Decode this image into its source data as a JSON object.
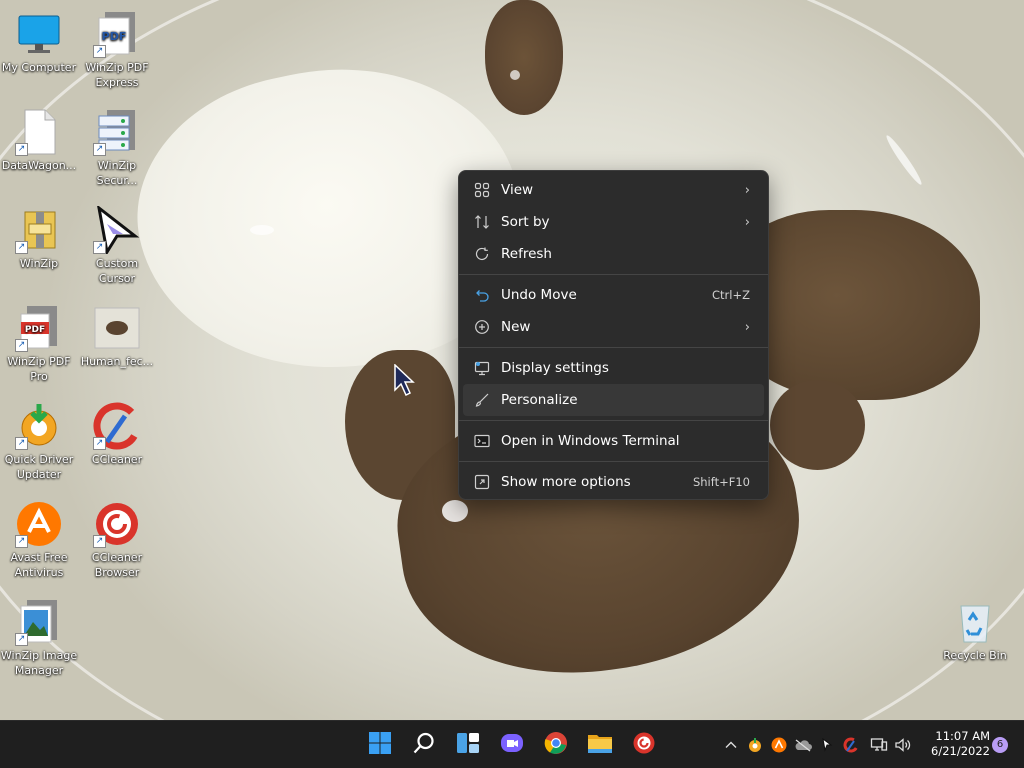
{
  "desktop_icons": [
    {
      "id": "my-computer",
      "label": "My Computer",
      "icon": "monitor-icon"
    },
    {
      "id": "winzip-pdf-express",
      "label": "WinZip PDF Express",
      "icon": "pdf-icon"
    },
    {
      "id": "datawagon",
      "label": "DataWagon...",
      "icon": "file-icon"
    },
    {
      "id": "winzip-secure",
      "label": "WinZip Secur...",
      "icon": "server-icon"
    },
    {
      "id": "winzip",
      "label": "WinZip",
      "icon": "winzip-icon"
    },
    {
      "id": "custom-cursor",
      "label": "Custom Cursor",
      "icon": "cursor-icon"
    },
    {
      "id": "winzip-pdf-pro",
      "label": "WinZip PDF Pro",
      "icon": "pdf-icon"
    },
    {
      "id": "human-fec",
      "label": "Human_fec...",
      "icon": "image-thumbnail-icon"
    },
    {
      "id": "quick-driver-updater",
      "label": "Quick Driver Updater",
      "icon": "driver-updater-icon"
    },
    {
      "id": "ccleaner",
      "label": "CCleaner",
      "icon": "ccleaner-icon"
    },
    {
      "id": "avast-free-antivirus",
      "label": "Avast Free Antivirus",
      "icon": "avast-icon"
    },
    {
      "id": "ccleaner-browser",
      "label": "CCleaner Browser",
      "icon": "ccleaner-browser-icon"
    },
    {
      "id": "winzip-image-manager",
      "label": "WinZip Image Manager",
      "icon": "image-manager-icon"
    },
    {
      "id": "recycle-bin",
      "label": "Recycle Bin",
      "icon": "recycle-bin-icon"
    }
  ],
  "context_menu": {
    "items": [
      {
        "label": "View",
        "icon": "grid-icon",
        "submenu": true
      },
      {
        "label": "Sort by",
        "icon": "sort-icon",
        "submenu": true
      },
      {
        "label": "Refresh",
        "icon": "refresh-icon"
      },
      {
        "label": "Undo Move",
        "icon": "undo-icon",
        "shortcut": "Ctrl+Z"
      },
      {
        "label": "New",
        "icon": "plus-circle-icon",
        "submenu": true
      },
      {
        "label": "Display settings",
        "icon": "display-icon"
      },
      {
        "label": "Personalize",
        "icon": "brush-icon",
        "hovered": true
      },
      {
        "label": "Open in Windows Terminal",
        "icon": "terminal-icon"
      },
      {
        "label": "Show more options",
        "icon": "more-options-icon",
        "shortcut": "Shift+F10"
      }
    ]
  },
  "taskbar": {
    "apps": [
      "start-icon",
      "search-icon",
      "widgets-icon",
      "chat-icon",
      "chrome-icon",
      "file-explorer-icon",
      "ccleaner-icon"
    ],
    "tray": [
      "chevron-up-icon",
      "driver-updater-icon",
      "avast-icon",
      "onedrive-icon",
      "cursor-icon",
      "ccleaner-icon",
      "network-icon",
      "volume-icon"
    ],
    "time": "11:07 AM",
    "date": "6/21/2022",
    "notifications": "6"
  }
}
